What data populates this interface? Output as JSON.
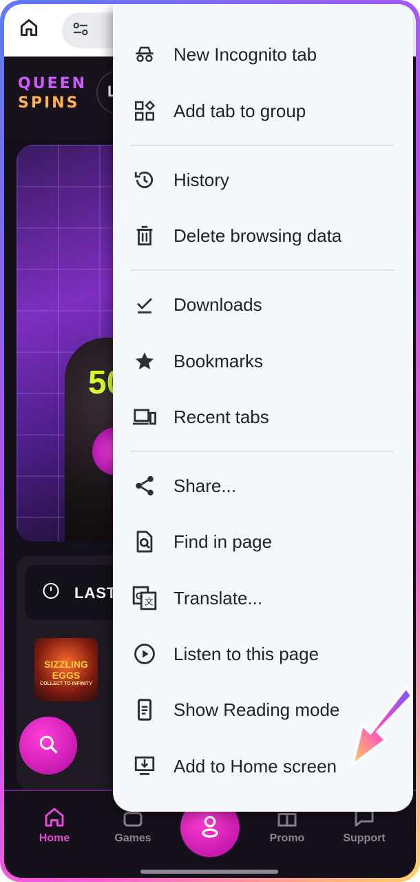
{
  "browser": {
    "home_icon": "home-icon",
    "site_settings_icon": "tune-icon"
  },
  "site": {
    "logo_line1": "QUEEN",
    "logo_line2": "SPINS",
    "header_pill": "L",
    "banner_text": "50",
    "last_played_label": "LAST",
    "game_thumb": "SIZZLING EGGS",
    "game_thumb_sub": "COLLECT TO INFINITY",
    "bottom_nav": [
      {
        "label": "Home",
        "icon": "home-icon",
        "active": true
      },
      {
        "label": "Games",
        "icon": "games-icon"
      },
      {
        "label": "Promo",
        "icon": "gift-icon"
      },
      {
        "label": "Support",
        "icon": "chat-icon"
      }
    ]
  },
  "menu": {
    "items": [
      {
        "label": "New Incognito tab",
        "icon": "incognito-icon"
      },
      {
        "label": "Add tab to group",
        "icon": "add-to-group-icon"
      },
      {
        "label": "History",
        "icon": "history-icon"
      },
      {
        "label": "Delete browsing data",
        "icon": "trash-icon"
      },
      {
        "label": "Downloads",
        "icon": "download-done-icon"
      },
      {
        "label": "Bookmarks",
        "icon": "star-icon"
      },
      {
        "label": "Recent tabs",
        "icon": "devices-icon"
      },
      {
        "label": "Share...",
        "icon": "share-icon"
      },
      {
        "label": "Find in page",
        "icon": "find-in-page-icon"
      },
      {
        "label": "Translate...",
        "icon": "translate-icon"
      },
      {
        "label": "Listen to this page",
        "icon": "play-circle-icon"
      },
      {
        "label": "Show Reading mode",
        "icon": "reading-mode-icon"
      },
      {
        "label": "Add to Home screen",
        "icon": "add-to-home-icon"
      }
    ]
  },
  "colors": {
    "accent_pink": "#e64bd8",
    "menu_bg": "#f4f8fc",
    "bonus_text": "#d6ff2a"
  }
}
